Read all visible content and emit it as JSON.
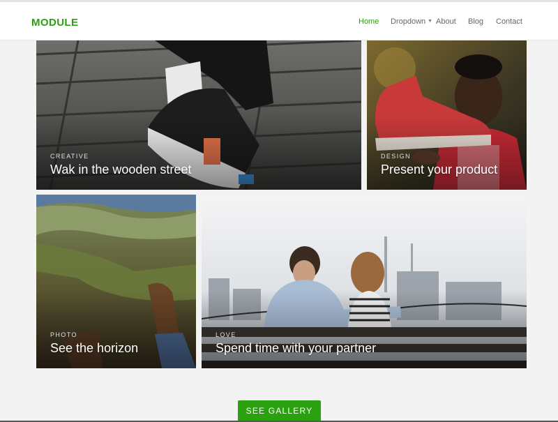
{
  "header": {
    "brand": "MODULE",
    "nav": [
      {
        "label": "Home",
        "active": true
      },
      {
        "label": "Dropdown",
        "has_submenu": true
      },
      {
        "label": "About"
      },
      {
        "label": "Blog"
      },
      {
        "label": "Contact"
      }
    ]
  },
  "gallery": {
    "tiles": [
      {
        "category": "CREATIVE",
        "title": "Wak in the wooden street"
      },
      {
        "category": "DESIGN",
        "title": "Present your product"
      },
      {
        "category": "PHOTO",
        "title": "See the horizon"
      },
      {
        "category": "LOVE",
        "title": "Spend time with your partner"
      }
    ]
  },
  "cta": {
    "label": "SEE GALLERY"
  },
  "colors": {
    "accent": "#2aa10f",
    "nav_text": "#666666",
    "page_bg": "#f3f3f3"
  },
  "icons": {
    "dropdown_caret": "chevron-down-icon"
  }
}
